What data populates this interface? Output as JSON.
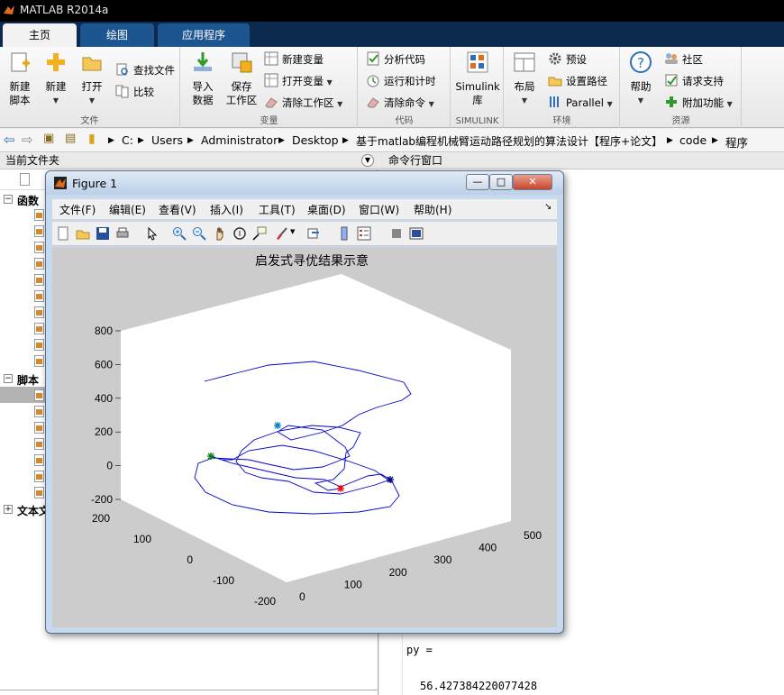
{
  "app": {
    "title": "MATLAB R2014a"
  },
  "tabs": [
    {
      "label": "主页",
      "active": true
    },
    {
      "label": "绘图",
      "active": false
    },
    {
      "label": "应用程序",
      "active": false
    }
  ],
  "ribbon": {
    "file": {
      "group": "文件",
      "new_script": [
        "新建",
        "脚本"
      ],
      "new": "新建",
      "open": "打开",
      "find_files": "查找文件",
      "compare": "比较"
    },
    "variable": {
      "group": "变量",
      "import": [
        "导入",
        "数据"
      ],
      "save": [
        "保存",
        "工作区"
      ],
      "new_var": "新建变量",
      "open_var": "打开变量",
      "clear_ws": "清除工作区"
    },
    "code": {
      "group": "代码",
      "analyze": "分析代码",
      "run_time": "运行和计时",
      "clear_cmd": "清除命令"
    },
    "simulink": {
      "group": "SIMULINK",
      "label": [
        "Simulink",
        "库"
      ]
    },
    "env": {
      "group": "环境",
      "layout": "布局",
      "prefs": "预设",
      "set_path": "设置路径",
      "parallel": "Parallel"
    },
    "resources": {
      "group": "资源",
      "help": "帮助",
      "community": "社区",
      "support": "请求支持",
      "addons": "附加功能"
    }
  },
  "address": [
    "C:",
    "Users",
    "Administrator",
    "Desktop",
    "基于matlab编程机械臂运动路径规划的算法设计【程序+论文】",
    "code",
    "程序"
  ],
  "left_panel": {
    "header": "当前文件夹",
    "section_functions": "函数",
    "section_scripts": "脚本",
    "section_text": "文本文"
  },
  "cmd_panel": {
    "header": "命令行窗口",
    "var_line": "py =",
    "value_line": "56.427384220077428"
  },
  "figure": {
    "title": "Figure 1",
    "menus": [
      "文件(F)",
      "编辑(E)",
      "查看(V)",
      "插入(I)",
      "工具(T)",
      "桌面(D)",
      "窗口(W)",
      "帮助(H)"
    ],
    "win_buttons": {
      "minimize": "—",
      "maximize": "□",
      "close": "✕"
    }
  },
  "chart_data": {
    "type": "line",
    "title": "启发式寻优结果示意",
    "z_ticks": [
      "800",
      "600",
      "400",
      "200",
      "0",
      "-200"
    ],
    "y_ticks": [
      "200",
      "100",
      "0",
      "-100",
      "-200"
    ],
    "x_ticks": [
      "0",
      "100",
      "200",
      "300",
      "400",
      "500"
    ],
    "zlim": [
      -200,
      800
    ],
    "ylim": [
      -200,
      200
    ],
    "xlim": [
      0,
      500
    ],
    "series": [
      {
        "marker_color": "#008000",
        "marker": "*"
      },
      {
        "marker_color": "#0080c0",
        "marker": "*"
      },
      {
        "marker_color": "#000080",
        "marker": "*"
      },
      {
        "marker_color": "#ff0000",
        "marker": "*"
      }
    ],
    "line_color": "#0000cc"
  }
}
